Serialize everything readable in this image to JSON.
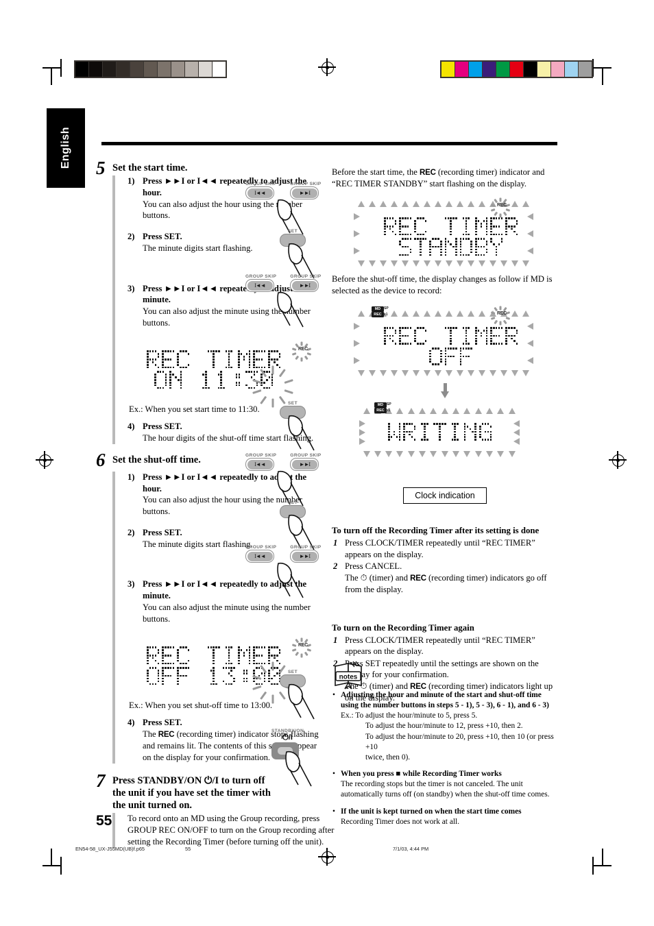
{
  "page": {
    "language_tab": "English",
    "page_number": "55"
  },
  "printbars": {
    "gray_steps": [
      "#000000",
      "#0d0a09",
      "#201c19",
      "#332d28",
      "#4a423c",
      "#625951",
      "#7c736b",
      "#9a918a",
      "#b8b1ab",
      "#dcd8d4",
      "#ffffff"
    ],
    "color_steps": [
      "#f5e400",
      "#e4007f",
      "#00a0e9",
      "#3b1d7a",
      "#009944",
      "#e50012",
      "#000000",
      "#f7f0a8",
      "#f4a9c0",
      "#9fd3f0",
      "#9e9e9e"
    ]
  },
  "left_column": {
    "step5": {
      "number": "5",
      "title": "Set the start time.",
      "substeps": [
        {
          "n": "1)",
          "bold": "Press ►►I or I◄◄ repeatedly to adjust the hour.",
          "body": "You can also adjust the hour using the number buttons."
        },
        {
          "n": "2)",
          "bold": "Press SET.",
          "body": "The minute digits start flashing."
        },
        {
          "n": "3)",
          "bold": "Press ►►I or I◄◄ repeatedly to adjust the minute.",
          "body": "You can also adjust the minute using the number buttons."
        },
        {
          "n": "4)",
          "bold": "Press SET.",
          "body": "The hour digits of the shut-off time start flashing."
        }
      ],
      "display": {
        "line1": "REC TIMER",
        "line2": "ON 11:30",
        "indicator": "REC"
      },
      "example": "Ex.:   When you set start time to 11:30."
    },
    "step6": {
      "number": "6",
      "title": "Set the shut-off time.",
      "substeps": [
        {
          "n": "1)",
          "bold": "Press ►►I or I◄◄ repeatedly to adjust the hour.",
          "body": "You can also adjust the hour using the number buttons."
        },
        {
          "n": "2)",
          "bold": "Press SET.",
          "body": "The minute digits start flashing."
        },
        {
          "n": "3)",
          "bold": "Press ►►I or I◄◄ repeatedly to adjust the minute.",
          "body": "You can also adjust the minute using the number buttons."
        },
        {
          "n": "4)",
          "bold": "Press SET.",
          "body_pre": "The ",
          "body_rec": "REC",
          "body_post": " (recording timer) indicator stops flashing and remains lit. The contents of this setting appear on the display for your confirmation."
        }
      ],
      "display": {
        "line1": "REC TIMER",
        "line2": "OFF 13:00",
        "indicator": "REC"
      },
      "example": "Ex.:   When you set shut-off time to 13:00."
    },
    "step7": {
      "number": "7",
      "title": "Press STANDBY/ON ⏻/I to turn off the unit if you have set the timer with the unit turned on.",
      "body": "To record onto an MD using the Group recording, press GROUP REC ON/OFF to turn on the Group recording after setting the Recording Timer (before turning off the unit).",
      "button_label": "STANDBY/ON",
      "button_glyph": "⏻/I"
    },
    "button_art": {
      "group_skip_label": "GROUP SKIP",
      "skip_back_glyph": "I◄◄",
      "skip_fwd_glyph": "►►I",
      "set_label": "SET"
    }
  },
  "right_column": {
    "intro1_pre": "Before the start time, the ",
    "intro1_rec": "REC",
    "intro1_post": " (recording timer) indicator and “REC TIMER STANDBY” start flashing on the display.",
    "display1": {
      "line1": "REC TIMER",
      "line2": "STANDBY",
      "indicator": "REC"
    },
    "intro2": "Before the shut-off time, the display changes as follow if MD is selected as the device to record:",
    "display2": {
      "line1": "REC TIMER",
      "line2": "OFF",
      "indicator": "REC",
      "md_label": "MD",
      "rec_label": "REC",
      "sp_label": "SP",
      "x1_label": "x1"
    },
    "display3": {
      "line1": "WRITING",
      "md_label": "MD",
      "rec_label": "REC",
      "sp_label": "SP",
      "x1_label": "x1"
    },
    "clock_box": "Clock indication",
    "section_off": {
      "heading": "To turn off the Recording Timer after its setting is done",
      "items": [
        {
          "n": "1",
          "text": "Press CLOCK/TIMER repeatedly until “REC TIMER” appears on the display."
        },
        {
          "n": "2",
          "text": "Press CANCEL.",
          "sub_pre": "The ⏱ (timer) and ",
          "sub_rec": "REC",
          "sub_post": " (recording timer) indicators go off from the display."
        }
      ]
    },
    "section_on": {
      "heading": "To turn on the Recording Timer again",
      "items": [
        {
          "n": "1",
          "text": "Press CLOCK/TIMER repeatedly until “REC TIMER” appears on the display."
        },
        {
          "n": "2",
          "text": "Press SET repeatedly until the settings are shown on the display for your confirmation.",
          "sub_pre": "The ⏱ (timer) and ",
          "sub_rec": "REC",
          "sub_post": " (recording timer) indicators light up on the display."
        }
      ]
    },
    "notes_icon_label": "notes",
    "notes": [
      {
        "bold": "Adjusting the hour and minute of the start and shut-off time using the number buttons in steps 5 - 1), 5 - 3), 6 - 1), and 6 - 3)",
        "lines": [
          "Ex.:  To adjust the hour/minute to 5, press 5.",
          "To adjust the hour/minute to 12, press +10, then 2.",
          "To adjust the hour/minute to 20, press +10, then 10 (or press +10",
          "twice, then 0)."
        ]
      },
      {
        "bold": "When you press ■ while Recording Timer works",
        "body": "The recording stops but the timer is not canceled. The unit automatically turns off (on standby) when the shut-off time comes."
      },
      {
        "bold": "If the unit is kept turned on when the start time comes",
        "body": "Recording Timer does not work at all."
      }
    ]
  },
  "footer": {
    "filename": "EN54-58_UX-J55MD(UB)f.p65",
    "page": "55",
    "timestamp": "7/1/03, 4:44 PM"
  }
}
